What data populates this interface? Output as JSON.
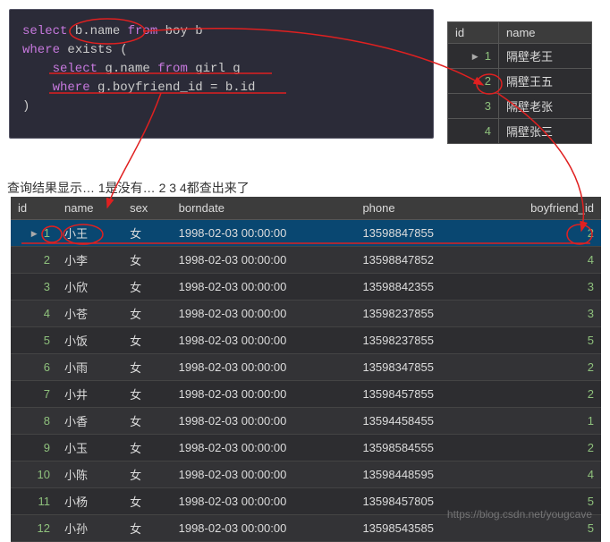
{
  "code": {
    "lines": [
      {
        "tokens": [
          {
            "t": "select ",
            "c": "kw"
          },
          {
            "t": "b.name ",
            "c": "plain"
          },
          {
            "t": "from ",
            "c": "kw"
          },
          {
            "t": "boy b",
            "c": "plain"
          }
        ]
      },
      {
        "tokens": [
          {
            "t": "where ",
            "c": "kw"
          },
          {
            "t": "exists (",
            "c": "plain"
          }
        ]
      },
      {
        "tokens": [
          {
            "t": "    select ",
            "c": "kw"
          },
          {
            "t": "g.name ",
            "c": "plain"
          },
          {
            "t": "from ",
            "c": "kw"
          },
          {
            "t": "girl g",
            "c": "plain"
          }
        ]
      },
      {
        "tokens": [
          {
            "t": "    where ",
            "c": "kw"
          },
          {
            "t": "g.boyfriend_id = b.id",
            "c": "plain"
          }
        ]
      },
      {
        "tokens": [
          {
            "t": ")",
            "c": "plain"
          }
        ]
      }
    ]
  },
  "boy_table": {
    "headers": [
      "id",
      "name"
    ],
    "rows": [
      {
        "id": "1",
        "name": "隔壁老王",
        "selected": true
      },
      {
        "id": "2",
        "name": "隔壁王五"
      },
      {
        "id": "3",
        "name": "隔壁老张"
      },
      {
        "id": "4",
        "name": "隔壁张三"
      }
    ]
  },
  "girl_table": {
    "headers": [
      "id",
      "name",
      "sex",
      "borndate",
      "phone",
      "boyfriend_id"
    ],
    "rows": [
      {
        "id": "1",
        "name": "小王",
        "sex": "女",
        "borndate": "1998-02-03 00:00:00",
        "phone": "13598847855",
        "bf": "2",
        "selected": true
      },
      {
        "id": "2",
        "name": "小李",
        "sex": "女",
        "borndate": "1998-02-03 00:00:00",
        "phone": "13598847852",
        "bf": "4"
      },
      {
        "id": "3",
        "name": "小欣",
        "sex": "女",
        "borndate": "1998-02-03 00:00:00",
        "phone": "13598842355",
        "bf": "3"
      },
      {
        "id": "4",
        "name": "小苍",
        "sex": "女",
        "borndate": "1998-02-03 00:00:00",
        "phone": "13598237855",
        "bf": "3"
      },
      {
        "id": "5",
        "name": "小饭",
        "sex": "女",
        "borndate": "1998-02-03 00:00:00",
        "phone": "13598237855",
        "bf": "5"
      },
      {
        "id": "6",
        "name": "小雨",
        "sex": "女",
        "borndate": "1998-02-03 00:00:00",
        "phone": "13598347855",
        "bf": "2"
      },
      {
        "id": "7",
        "name": "小井",
        "sex": "女",
        "borndate": "1998-02-03 00:00:00",
        "phone": "13598457855",
        "bf": "2"
      },
      {
        "id": "8",
        "name": "小香",
        "sex": "女",
        "borndate": "1998-02-03 00:00:00",
        "phone": "13594458455",
        "bf": "1"
      },
      {
        "id": "9",
        "name": "小玉",
        "sex": "女",
        "borndate": "1998-02-03 00:00:00",
        "phone": "13598584555",
        "bf": "2"
      },
      {
        "id": "10",
        "name": "小陈",
        "sex": "女",
        "borndate": "1998-02-03 00:00:00",
        "phone": "13598448595",
        "bf": "4"
      },
      {
        "id": "11",
        "name": "小杨",
        "sex": "女",
        "borndate": "1998-02-03 00:00:00",
        "phone": "13598457805",
        "bf": "5"
      },
      {
        "id": "12",
        "name": "小孙",
        "sex": "女",
        "borndate": "1998-02-03 00:00:00",
        "phone": "13598543585",
        "bf": "5"
      }
    ]
  },
  "bg_text": "查询结果显示…  1是没有…  2 3 4都查出来了",
  "watermark": "https://blog.csdn.net/yougcave"
}
